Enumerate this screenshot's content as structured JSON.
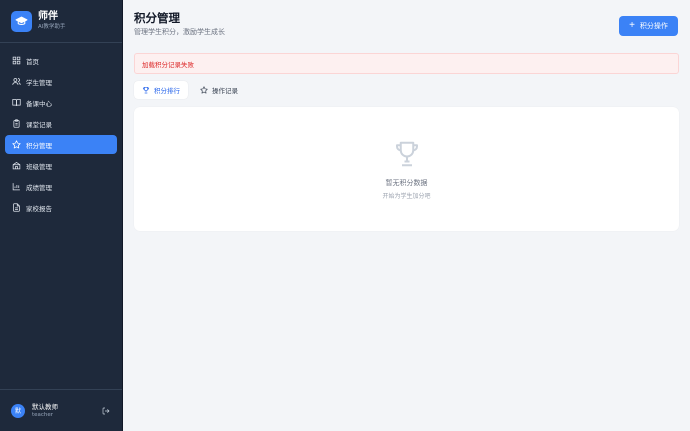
{
  "brand": {
    "name": "师伴",
    "subtitle": "AI教学助手"
  },
  "nav": [
    {
      "label": "首页",
      "icon": "grid-icon"
    },
    {
      "label": "学生管理",
      "icon": "users-icon"
    },
    {
      "label": "备课中心",
      "icon": "book-icon"
    },
    {
      "label": "课堂记录",
      "icon": "clipboard-icon"
    },
    {
      "label": "积分管理",
      "icon": "star-icon",
      "active": true
    },
    {
      "label": "班级管理",
      "icon": "school-icon"
    },
    {
      "label": "成绩管理",
      "icon": "bar-chart-icon"
    },
    {
      "label": "家校报告",
      "icon": "document-icon"
    }
  ],
  "user": {
    "avatar": "默",
    "name": "默认教师",
    "role": "teacher"
  },
  "header": {
    "title": "积分管理",
    "subtitle": "管理学生积分，激励学生成长",
    "action_label": "积分操作"
  },
  "alert": {
    "message": "加载积分记录失败"
  },
  "tabs": [
    {
      "label": "积分排行",
      "active": true
    },
    {
      "label": "操作记录",
      "active": false
    }
  ],
  "empty": {
    "title": "暂无积分数据",
    "subtitle": "开始为学生加分吧"
  },
  "colors": {
    "accent": "#3b82f6",
    "sidebar": "#1e293b",
    "error": "#dc2626"
  }
}
